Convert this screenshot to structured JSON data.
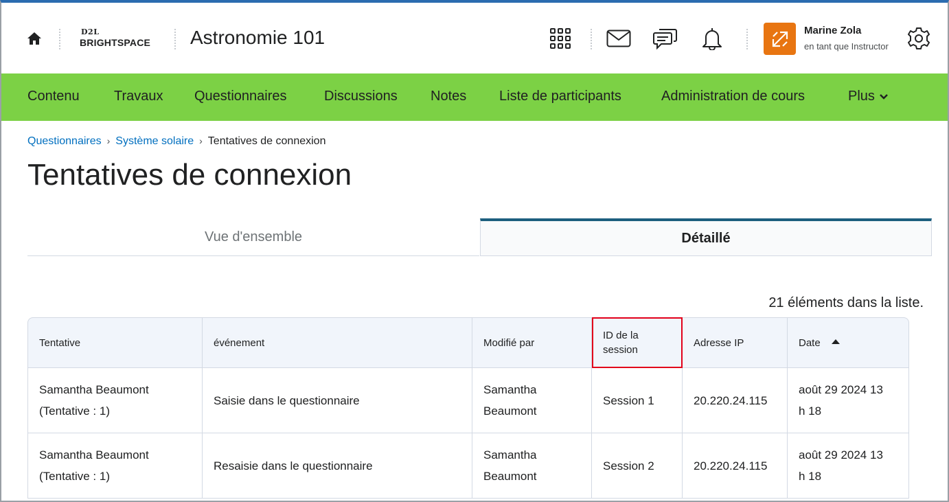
{
  "header": {
    "logo_top": "D2L",
    "logo_bottom": "BRIGHTSPACE",
    "course_title": "Astronomie 101",
    "icons": [
      "home-icon",
      "app-grid-icon",
      "mail-icon",
      "chat-icon",
      "bell-icon",
      "impersonate-icon",
      "gear-icon"
    ],
    "user_name": "Marine Zola",
    "user_role": "en tant que Instructor",
    "avatar_color": "#e87511"
  },
  "nav": {
    "bar_color": "#7cd145",
    "items": [
      "Contenu",
      "Travaux",
      "Questionnaires",
      "Discussions",
      "Notes",
      "Liste de participants",
      "Administration de cours"
    ],
    "more_label": "Plus"
  },
  "breadcrumb": {
    "items": [
      "Questionnaires",
      "Système solaire"
    ],
    "current": "Tentatives de connexion"
  },
  "page_title": "Tentatives de connexion",
  "tabs": {
    "overview": "Vue d'ensemble",
    "detail": "Détaillé",
    "active": "detail"
  },
  "count_text": "21 éléments dans la liste.",
  "table": {
    "headers": [
      "Tentative",
      "événement",
      "Modifié par",
      "ID de la session",
      "Adresse IP",
      "Date"
    ],
    "sort_column": "Date",
    "sort_direction": "ascending",
    "rows": [
      {
        "attempt_name": "Samantha Beaumont",
        "attempt_num": "(Tentative : 1)",
        "event": "Saisie dans le questionnaire",
        "modified_by_1": "Samantha",
        "modified_by_2": "Beaumont",
        "session": "Session 1",
        "ip": "20.220.24.115",
        "date_1": "août 29 2024 13",
        "date_2": "h 18"
      },
      {
        "attempt_name": "Samantha Beaumont",
        "attempt_num": "(Tentative : 1)",
        "event": "Resaisie dans le questionnaire",
        "modified_by_1": "Samantha",
        "modified_by_2": "Beaumont",
        "session": "Session 2",
        "ip": "20.220.24.115",
        "date_1": "août 29 2024 13",
        "date_2": "h 18"
      }
    ]
  },
  "highlight_color": "#e2001a"
}
